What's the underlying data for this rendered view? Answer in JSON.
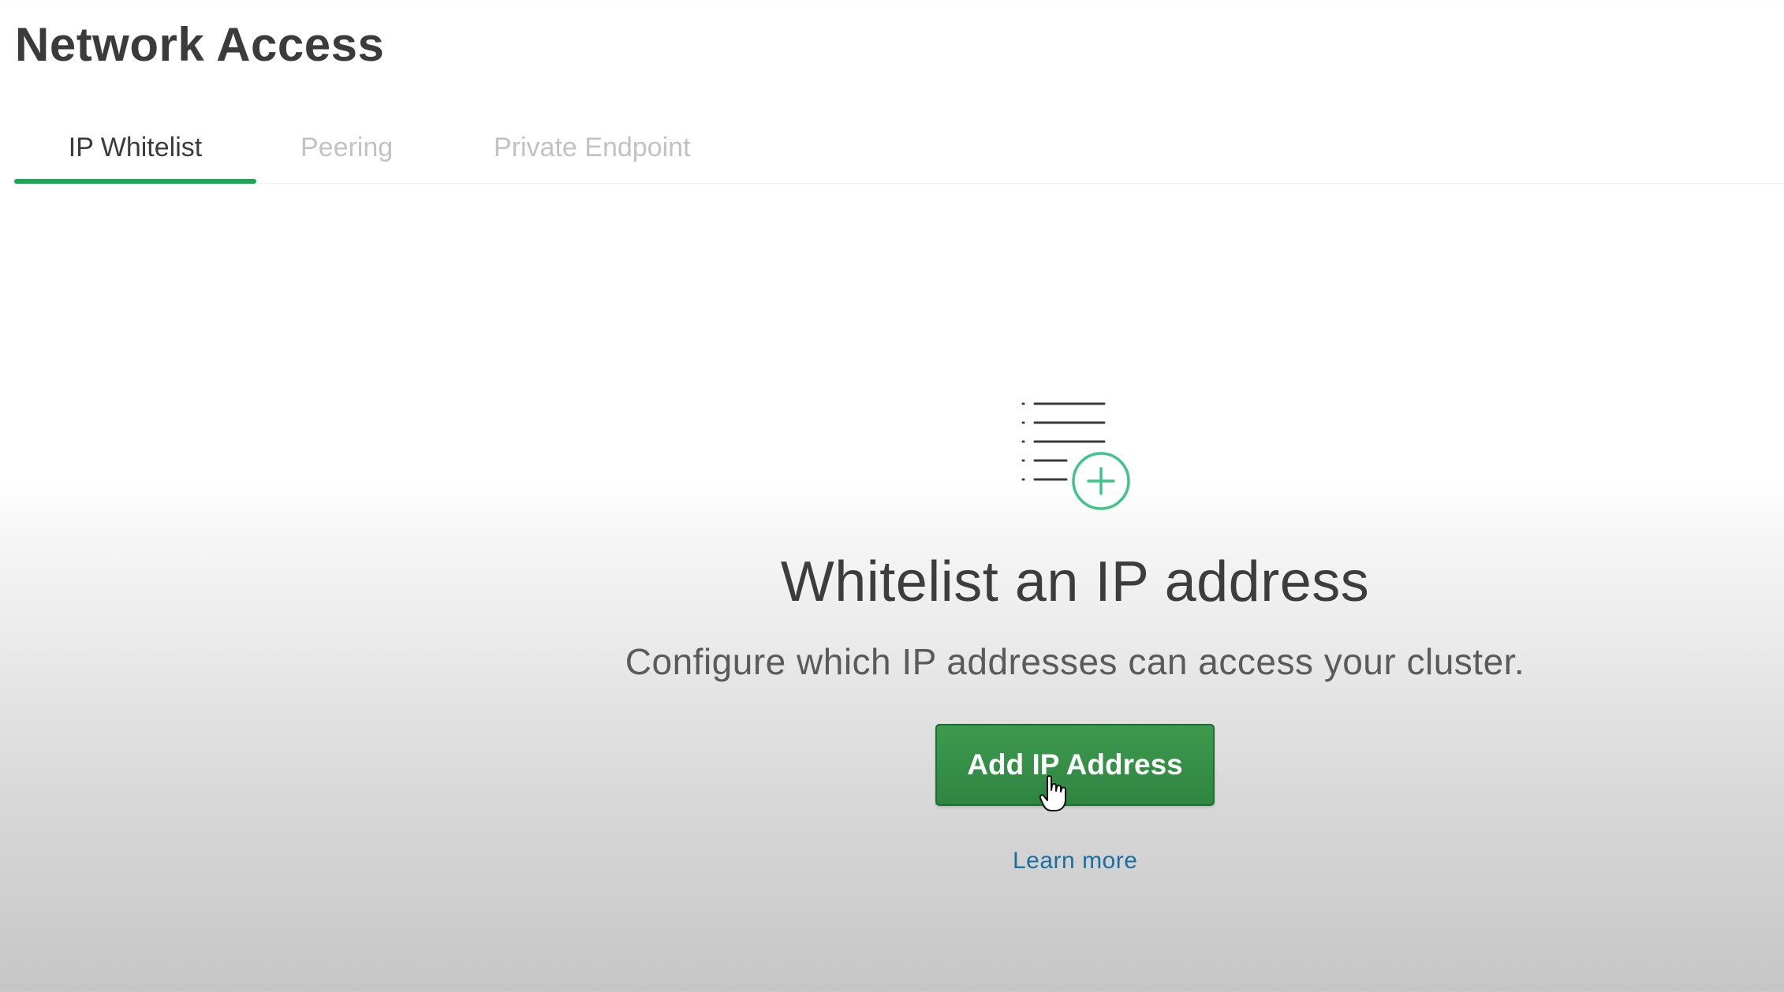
{
  "page": {
    "title": "Network Access"
  },
  "tabs": [
    {
      "label": "IP Whitelist",
      "active": true
    },
    {
      "label": "Peering",
      "active": false
    },
    {
      "label": "Private Endpoint",
      "active": false
    }
  ],
  "empty_state": {
    "icon": "list-add-icon",
    "title": "Whitelist an IP address",
    "subtitle": "Configure which IP addresses can access your cluster.",
    "button_label": "Add IP Address",
    "link_label": "Learn more"
  },
  "colors": {
    "accent": "#13aa52",
    "button": "#2e8540",
    "link": "#1a6fa1"
  }
}
